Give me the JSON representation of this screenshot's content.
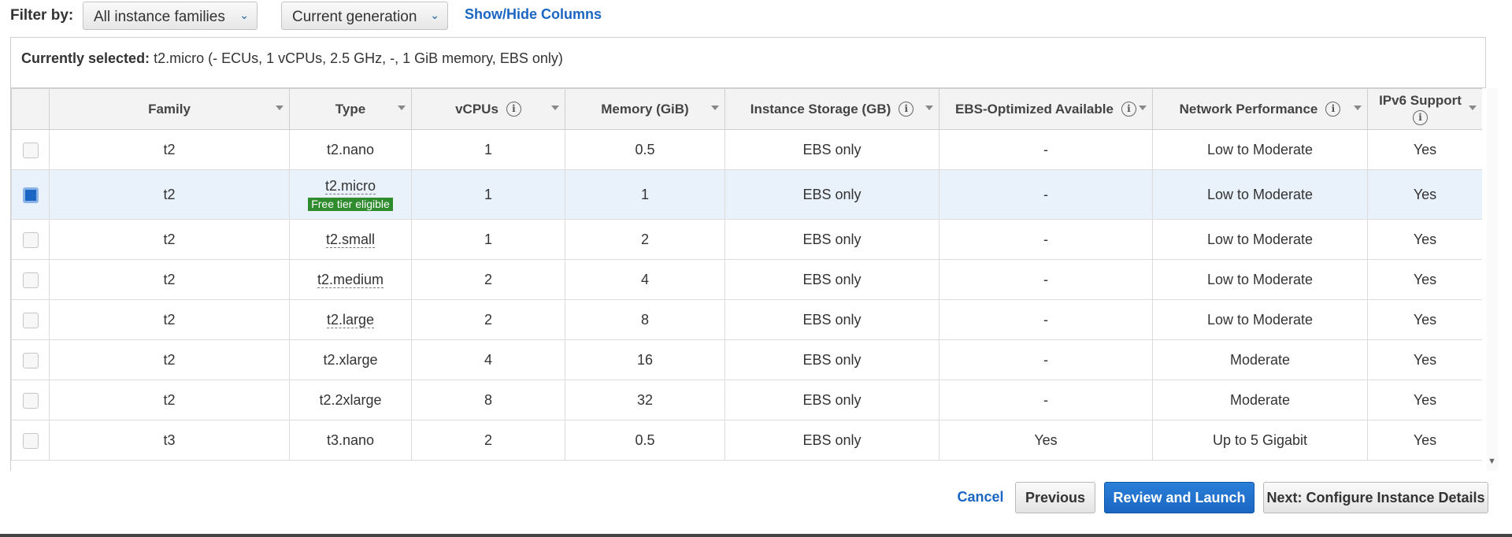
{
  "filter": {
    "label": "Filter by:",
    "family_select": "All instance families",
    "generation_select": "Current generation",
    "columns_link": "Show/Hide Columns"
  },
  "selected": {
    "prefix": "Currently selected:",
    "detail": "t2.micro (- ECUs, 1 vCPUs, 2.5 GHz, -, 1 GiB memory, EBS only)"
  },
  "table": {
    "headers": {
      "family": "Family",
      "type": "Type",
      "vcpus": "vCPUs",
      "memory": "Memory (GiB)",
      "storage": "Instance Storage (GB)",
      "ebs": "EBS-Optimized Available",
      "network": "Network Performance",
      "ipv6": "IPv6 Support"
    },
    "free_tier_badge": "Free tier eligible",
    "rows": [
      {
        "family": "t2",
        "type": "t2.nano",
        "vcpus": "1",
        "memory": "0.5",
        "storage": "EBS only",
        "ebs": "-",
        "network": "Low to Moderate",
        "ipv6": "Yes",
        "selected": false
      },
      {
        "family": "t2",
        "type": "t2.micro",
        "vcpus": "1",
        "memory": "1",
        "storage": "EBS only",
        "ebs": "-",
        "network": "Low to Moderate",
        "ipv6": "Yes",
        "selected": true
      },
      {
        "family": "t2",
        "type": "t2.small",
        "vcpus": "1",
        "memory": "2",
        "storage": "EBS only",
        "ebs": "-",
        "network": "Low to Moderate",
        "ipv6": "Yes",
        "selected": false
      },
      {
        "family": "t2",
        "type": "t2.medium",
        "vcpus": "2",
        "memory": "4",
        "storage": "EBS only",
        "ebs": "-",
        "network": "Low to Moderate",
        "ipv6": "Yes",
        "selected": false
      },
      {
        "family": "t2",
        "type": "t2.large",
        "vcpus": "2",
        "memory": "8",
        "storage": "EBS only",
        "ebs": "-",
        "network": "Low to Moderate",
        "ipv6": "Yes",
        "selected": false
      },
      {
        "family": "t2",
        "type": "t2.xlarge",
        "vcpus": "4",
        "memory": "16",
        "storage": "EBS only",
        "ebs": "-",
        "network": "Moderate",
        "ipv6": "Yes",
        "selected": false
      },
      {
        "family": "t2",
        "type": "t2.2xlarge",
        "vcpus": "8",
        "memory": "32",
        "storage": "EBS only",
        "ebs": "-",
        "network": "Moderate",
        "ipv6": "Yes",
        "selected": false
      },
      {
        "family": "t3",
        "type": "t3.nano",
        "vcpus": "2",
        "memory": "0.5",
        "storage": "EBS only",
        "ebs": "Yes",
        "network": "Up to 5 Gigabit",
        "ipv6": "Yes",
        "selected": false
      }
    ]
  },
  "actions": {
    "cancel": "Cancel",
    "previous": "Previous",
    "review": "Review and Launch",
    "next": "Next: Configure Instance Details"
  },
  "colors": {
    "primary": "#1a66c2",
    "badge": "#2e8b2e",
    "selected_row": "#e9f1fb"
  },
  "icons": {
    "info": "info-icon",
    "dropdown": "chevron-down-icon",
    "sort": "sort-caret-icon"
  }
}
